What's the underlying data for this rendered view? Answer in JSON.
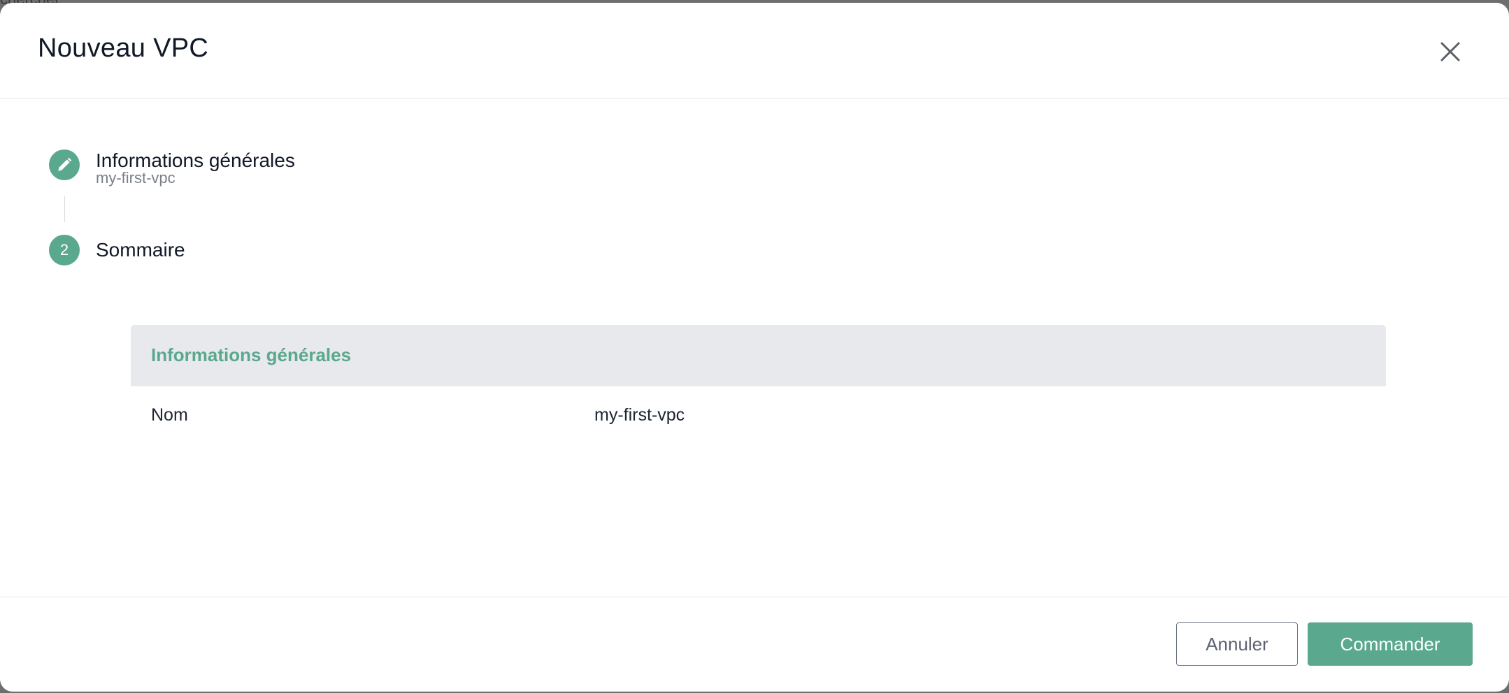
{
  "backdrop": {
    "partial_text": "chercher"
  },
  "modal": {
    "title": "Nouveau VPC"
  },
  "steps": [
    {
      "index": "1",
      "icon": "pencil-icon",
      "title": "Informations générales",
      "subtitle": "my-first-vpc"
    },
    {
      "index": "2",
      "title": "Sommaire"
    }
  ],
  "summary": {
    "section_title": "Informations générales",
    "rows": [
      {
        "label": "Nom",
        "value": "my-first-vpc"
      }
    ]
  },
  "footer": {
    "cancel_label": "Annuler",
    "submit_label": "Commander"
  },
  "colors": {
    "accent": "#5aa88d",
    "header_bg": "#e8e9ec"
  }
}
